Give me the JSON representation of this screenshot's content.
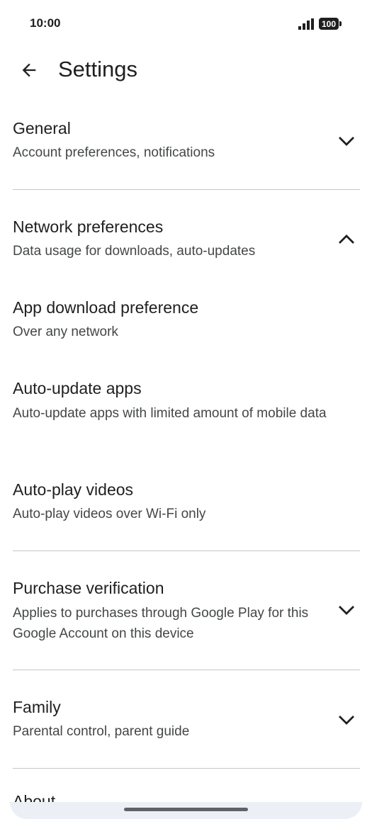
{
  "status": {
    "time": "10:00",
    "battery": "100"
  },
  "header": {
    "title": "Settings"
  },
  "sections": {
    "general": {
      "title": "General",
      "subtitle": "Account preferences, notifications"
    },
    "network": {
      "title": "Network preferences",
      "subtitle": "Data usage for downloads, auto-updates"
    },
    "app_download": {
      "title": "App download preference",
      "subtitle": "Over any network"
    },
    "auto_update": {
      "title": "Auto-update apps",
      "subtitle": "Auto-update apps with limited amount of mobile data"
    },
    "auto_play": {
      "title": "Auto-play videos",
      "subtitle": "Auto-play videos over Wi-Fi only"
    },
    "purchase": {
      "title": "Purchase verification",
      "subtitle": "Applies to purchases through Google Play for this Google Account on this device"
    },
    "family": {
      "title": "Family",
      "subtitle": "Parental control, parent guide"
    },
    "about": {
      "title": "About"
    }
  },
  "icons": {
    "back": "arrow-back-icon",
    "expand": "chevron-down-icon",
    "collapse": "chevron-up-icon"
  }
}
